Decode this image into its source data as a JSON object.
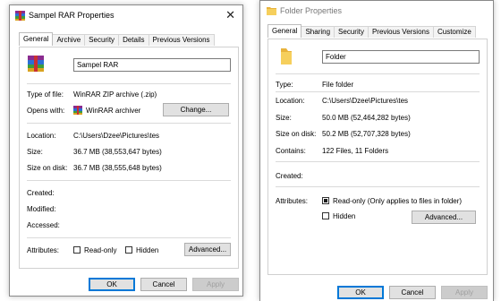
{
  "left": {
    "title": "Sampel RAR Properties",
    "close_glyph": "✕",
    "tabs": [
      "General",
      "Archive",
      "Security",
      "Details",
      "Previous Versions"
    ],
    "filename": "Sampel RAR",
    "type_label": "Type of file:",
    "type_value": "WinRAR ZIP archive (.zip)",
    "opens_label": "Opens with:",
    "opens_value": "WinRAR archiver",
    "change_btn": "Change...",
    "location_label": "Location:",
    "location_value": "C:\\Users\\Dzee\\Pictures\\tes",
    "size_label": "Size:",
    "size_value": "36.7 MB (38,553,647 bytes)",
    "sizedisk_label": "Size on disk:",
    "sizedisk_value": "36.7 MB (38,555,648 bytes)",
    "created_label": "Created:",
    "modified_label": "Modified:",
    "accessed_label": "Accessed:",
    "attributes_label": "Attributes:",
    "readonly_label": "Read-only",
    "hidden_label": "Hidden",
    "advanced_btn": "Advanced...",
    "ok_btn": "OK",
    "cancel_btn": "Cancel",
    "apply_btn": "Apply"
  },
  "right": {
    "title": "Folder Properties",
    "tabs": [
      "General",
      "Sharing",
      "Security",
      "Previous Versions",
      "Customize"
    ],
    "foldername": "Folder",
    "type_label": "Type:",
    "type_value": "File folder",
    "location_label": "Location:",
    "location_value": "C:\\Users\\Dzee\\Pictures\\tes",
    "size_label": "Size:",
    "size_value": "50.0 MB (52,464,282 bytes)",
    "sizedisk_label": "Size on disk:",
    "sizedisk_value": "50.2 MB (52,707,328 bytes)",
    "contains_label": "Contains:",
    "contains_value": "122 Files, 11 Folders",
    "created_label": "Created:",
    "attributes_label": "Attributes:",
    "readonly_label": "Read-only (Only applies to files in folder)",
    "hidden_label": "Hidden",
    "advanced_btn": "Advanced...",
    "ok_btn": "OK",
    "cancel_btn": "Cancel",
    "apply_btn": "Apply"
  },
  "colors": {
    "accent": "#0078d7",
    "folder": "#f0c24a"
  }
}
